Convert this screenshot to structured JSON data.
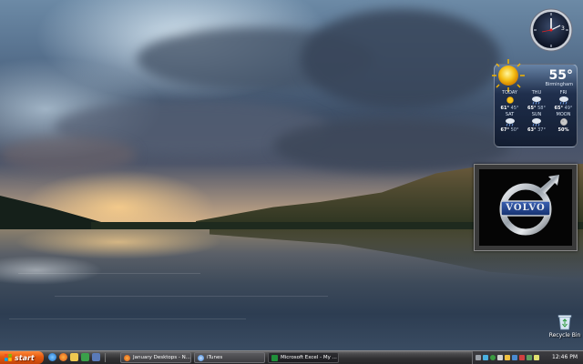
{
  "desktop": {
    "recycle_bin_label": "Recycle Bin"
  },
  "clock_gadget": {
    "hour_number": "3"
  },
  "weather": {
    "current_temp": "55°",
    "location": "Birmingham",
    "forecast": [
      {
        "day": "TODAY",
        "hi": "61°",
        "lo": "45°",
        "icon": "sunny-icon"
      },
      {
        "day": "THU",
        "hi": "65°",
        "lo": "58°",
        "icon": "rain-icon"
      },
      {
        "day": "FRI",
        "hi": "65°",
        "lo": "49°",
        "icon": "rain-icon"
      },
      {
        "day": "SAT",
        "hi": "67°",
        "lo": "50°",
        "icon": "rain-icon"
      },
      {
        "day": "SUN",
        "hi": "63°",
        "lo": "37°",
        "icon": "rain-icon"
      },
      {
        "day": "MOON",
        "hi": "50%",
        "lo": "",
        "icon": "moon-icon"
      }
    ]
  },
  "slideshow": {
    "logo_text": "VOLVO"
  },
  "taskbar": {
    "start_label": "start",
    "tasks": [
      {
        "label": "January Desktops - N...",
        "icon": "firefox-icon",
        "active": false
      },
      {
        "label": "iTunes",
        "icon": "itunes-icon",
        "active": false
      },
      {
        "label": "Microsoft Excel - My ...",
        "icon": "excel-icon",
        "active": true
      }
    ],
    "time": "12:46 PM"
  },
  "colors": {
    "start_orange": "#e45a10",
    "taskbar_dark": "#2f2f31",
    "volvo_blue": "#1f3f8a"
  }
}
